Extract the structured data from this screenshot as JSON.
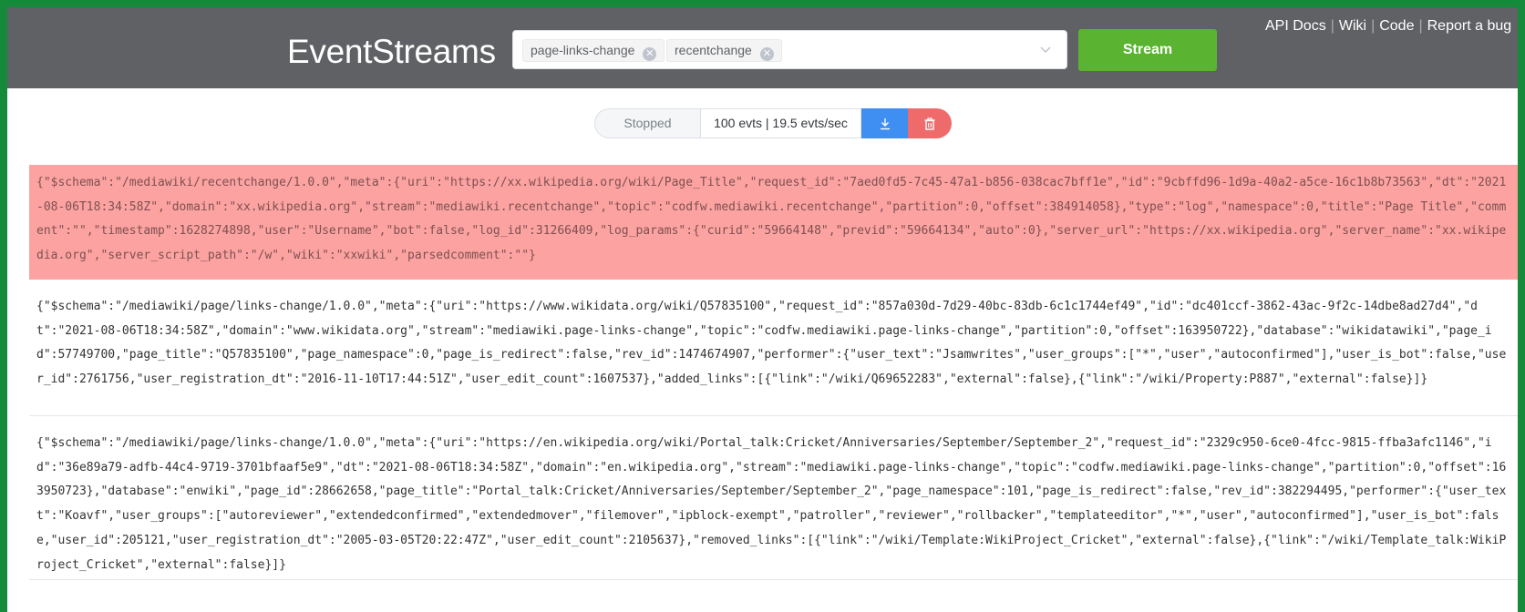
{
  "app": {
    "title": "EventStreams",
    "accent_colors": {
      "header": "#5f6164",
      "stream": "#5ab431",
      "download": "#3f8ef2",
      "delete": "#ef6b6b",
      "error_row": "#fca3a2"
    }
  },
  "header": {
    "streams_selected": [
      {
        "label": "page-links-change",
        "icon": "close-icon"
      },
      {
        "label": "recentchange",
        "icon": "close-icon"
      }
    ],
    "dropdown_icon": "chevron-down-icon",
    "stream_button": "Stream",
    "links": [
      "API Docs",
      "Wiki",
      "Code",
      "Report a bug"
    ],
    "link_separator": "|"
  },
  "controls": {
    "status": "Stopped",
    "counter": "100 evts | 19.5 evts/sec",
    "download_icon": "download-icon",
    "delete_icon": "trash-icon"
  },
  "events": [
    {
      "highlight": true,
      "text": "{\"$schema\":\"/mediawiki/recentchange/1.0.0\",\"meta\":{\"uri\":\"https://xx.wikipedia.org/wiki/Page_Title\",\"request_id\":\"7aed0fd5-7c45-47a1-b856-038cac7bff1e\",\"id\":\"9cbffd96-1d9a-40a2-a5ce-16c1b8b73563\",\"dt\":\"2021-08-06T18:34:58Z\",\"domain\":\"xx.wikipedia.org\",\"stream\":\"mediawiki.recentchange\",\"topic\":\"codfw.mediawiki.recentchange\",\"partition\":0,\"offset\":384914058},\"type\":\"log\",\"namespace\":0,\"title\":\"Page Title\",\"comment\":\"\",\"timestamp\":1628274898,\"user\":\"Username\",\"bot\":false,\"log_id\":31266409,\"log_params\":{\"curid\":\"59664148\",\"previd\":\"59664134\",\"auto\":0},\"server_url\":\"https://xx.wikipedia.org\",\"server_name\":\"xx.wikipedia.org\",\"server_script_path\":\"/w\",\"wiki\":\"xxwiki\",\"parsedcomment\":\"\"}"
    },
    {
      "highlight": false,
      "text": "{\"$schema\":\"/mediawiki/page/links-change/1.0.0\",\"meta\":{\"uri\":\"https://www.wikidata.org/wiki/Q57835100\",\"request_id\":\"857a030d-7d29-40bc-83db-6c1c1744ef49\",\"id\":\"dc401ccf-3862-43ac-9f2c-14dbe8ad27d4\",\"dt\":\"2021-08-06T18:34:58Z\",\"domain\":\"www.wikidata.org\",\"stream\":\"mediawiki.page-links-change\",\"topic\":\"codfw.mediawiki.page-links-change\",\"partition\":0,\"offset\":163950722},\"database\":\"wikidatawiki\",\"page_id\":57749700,\"page_title\":\"Q57835100\",\"page_namespace\":0,\"page_is_redirect\":false,\"rev_id\":1474674907,\"performer\":{\"user_text\":\"Jsamwrites\",\"user_groups\":[\"*\",\"user\",\"autoconfirmed\"],\"user_is_bot\":false,\"user_id\":2761756,\"user_registration_dt\":\"2016-11-10T17:44:51Z\",\"user_edit_count\":1607537},\"added_links\":[{\"link\":\"/wiki/Q69652283\",\"external\":false},{\"link\":\"/wiki/Property:P887\",\"external\":false}]}"
    },
    {
      "highlight": false,
      "text": "{\"$schema\":\"/mediawiki/page/links-change/1.0.0\",\"meta\":{\"uri\":\"https://en.wikipedia.org/wiki/Portal_talk:Cricket/Anniversaries/September/September_2\",\"request_id\":\"2329c950-6ce0-4fcc-9815-ffba3afc1146\",\"id\":\"36e89a79-adfb-44c4-9719-3701bfaaf5e9\",\"dt\":\"2021-08-06T18:34:58Z\",\"domain\":\"en.wikipedia.org\",\"stream\":\"mediawiki.page-links-change\",\"topic\":\"codfw.mediawiki.page-links-change\",\"partition\":0,\"offset\":163950723},\"database\":\"enwiki\",\"page_id\":28662658,\"page_title\":\"Portal_talk:Cricket/Anniversaries/September/September_2\",\"page_namespace\":101,\"page_is_redirect\":false,\"rev_id\":382294495,\"performer\":{\"user_text\":\"Koavf\",\"user_groups\":[\"autoreviewer\",\"extendedconfirmed\",\"extendedmover\",\"filemover\",\"ipblock-exempt\",\"patroller\",\"reviewer\",\"rollbacker\",\"templateeditor\",\"*\",\"user\",\"autoconfirmed\"],\"user_is_bot\":false,\"user_id\":205121,\"user_registration_dt\":\"2005-03-05T20:22:47Z\",\"user_edit_count\":2105637},\"removed_links\":[{\"link\":\"/wiki/Template:WikiProject_Cricket\",\"external\":false},{\"link\":\"/wiki/Template_talk:WikiProject_Cricket\",\"external\":false}]}"
    }
  ]
}
